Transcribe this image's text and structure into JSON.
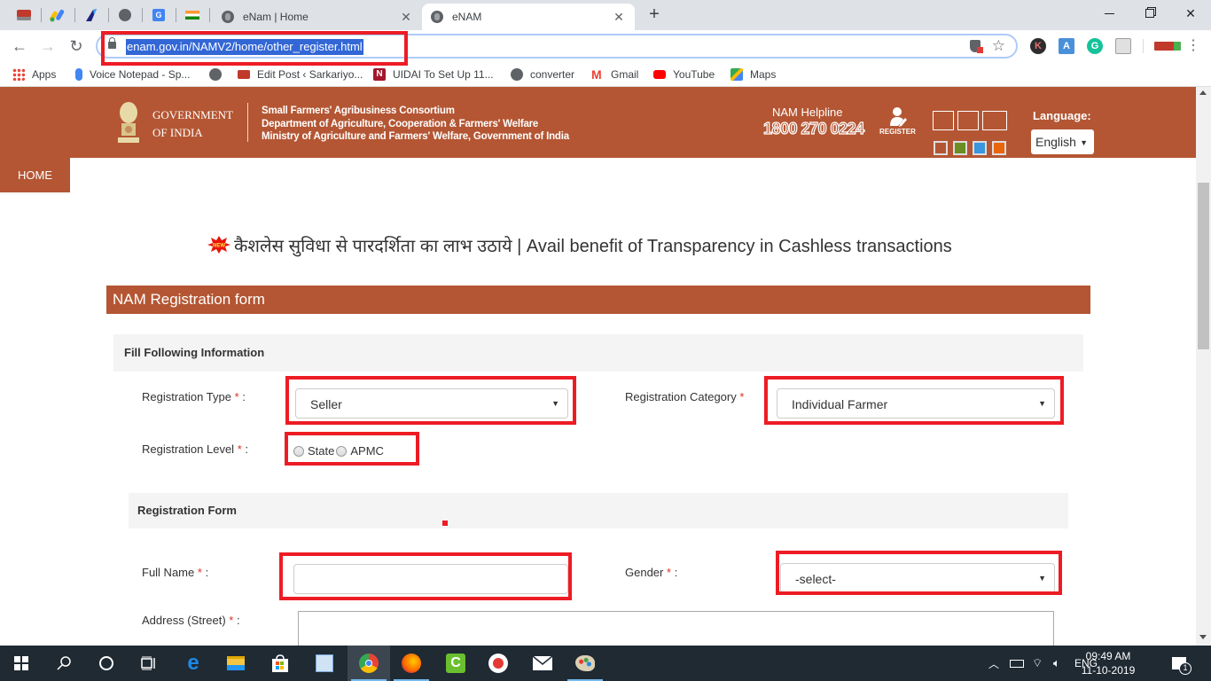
{
  "browser": {
    "pinned_tabs": [
      {
        "name": "sarkari-tab",
        "color": "#c0392b"
      },
      {
        "name": "adsense-tab",
        "color": "#fbbc04"
      },
      {
        "name": "app-tab",
        "color": "#1a73e8"
      },
      {
        "name": "globe-tab",
        "color": "#5f6368"
      },
      {
        "name": "translate-tab",
        "color": "#4285f4"
      },
      {
        "name": "india-flag-tab",
        "color": "#ff9933"
      }
    ],
    "tabs": [
      {
        "title": "eNam | Home",
        "active": false
      },
      {
        "title": "eNAM",
        "active": true
      }
    ],
    "new_tab_label": "+",
    "url": "enam.gov.in/NAMV2/home/other_register.html",
    "bookmarks": [
      {
        "label": "Apps",
        "icon": "apps-grid-icon"
      },
      {
        "label": "Voice Notepad - Sp...",
        "icon": "microphone-icon"
      },
      {
        "label": "",
        "icon": "globe-icon"
      },
      {
        "label": "Edit Post ‹ Sarkariyo...",
        "icon": "sarkari-icon"
      },
      {
        "label": "UIDAI To Set Up 11...",
        "icon": "n-logo-icon"
      },
      {
        "label": "converter",
        "icon": "globe-icon"
      },
      {
        "label": "Gmail",
        "icon": "gmail-icon"
      },
      {
        "label": "YouTube",
        "icon": "youtube-icon"
      },
      {
        "label": "Maps",
        "icon": "maps-icon"
      }
    ],
    "extensions": [
      {
        "name": "k-extension",
        "letter": "K",
        "color": "#2d2d2d"
      },
      {
        "name": "keyboard-extension",
        "letter": "A",
        "color": "#4a90d9"
      },
      {
        "name": "grammarly-extension",
        "letter": "G",
        "color": "#15c39a"
      },
      {
        "name": "cast-extension",
        "letter": "",
        "color": "#9e9e9e"
      }
    ]
  },
  "site": {
    "gov_line1": "GOVERNMENT",
    "gov_line2": "OF INDIA",
    "org_line1": "Small Farmers' Agribusiness Consortium",
    "org_line2": "Department of Agriculture, Cooperation & Farmers' Welfare",
    "org_line3": "Ministry of Agriculture and Farmers' Welfare, Government of India",
    "helpline_label": "NAM Helpline",
    "helpline_number": "1800 270 0224",
    "register_label": "REGISTER",
    "language_label": "Language:",
    "language_value": "English",
    "theme_colors": [
      "#b45633",
      "#6b8e23",
      "#3a96dd",
      "#e8650c"
    ],
    "brand_color": "#b45633",
    "nav_home": "HOME",
    "marquee_text": "कैशलेस सुविधा से पारदर्शिता का लाभ उठाये | Avail benefit of Transparency in Cashless transactions"
  },
  "form": {
    "title": "NAM Registration form",
    "section1_title": "Fill Following Information",
    "registration_type_label": "Registration Type",
    "registration_type_value": "Seller",
    "registration_category_label": "Registration Category",
    "registration_category_value": "Individual Farmer",
    "registration_level_label": "Registration Level",
    "registration_level_options": [
      "State",
      "APMC"
    ],
    "section2_title": "Registration Form",
    "full_name_label": "Full Name",
    "full_name_value": "",
    "gender_label": "Gender",
    "gender_value": "-select-",
    "address_label": "Address (Street)",
    "address_value": "",
    "required_mark": "*",
    "colon": ":"
  },
  "taskbar": {
    "apps": [
      "start",
      "search",
      "cortana",
      "task-view",
      "edge",
      "file-explorer",
      "store",
      "search-app",
      "chrome",
      "firefox",
      "camtasia",
      "recorder",
      "mail",
      "paint"
    ],
    "language": "ENG",
    "time": "09:49 AM",
    "date": "11-10-2019",
    "notifications": "1"
  }
}
